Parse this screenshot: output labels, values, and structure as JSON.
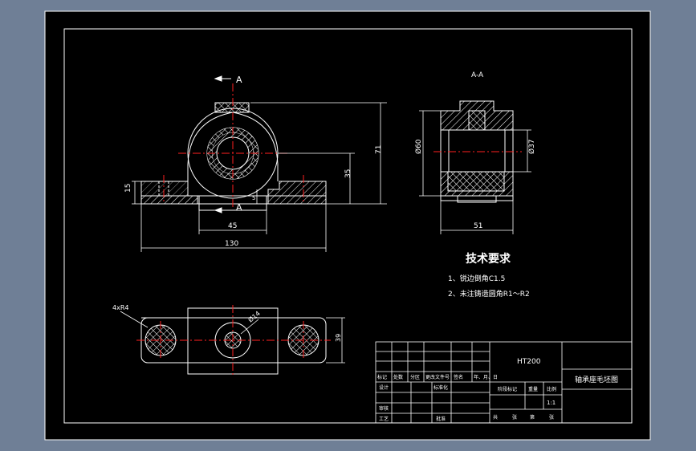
{
  "drawing": {
    "section_mark_top": "A",
    "section_mark_bottom": "A",
    "section_view_title": "A-A",
    "dimensions": {
      "front_height_total": "71",
      "front_center_height": "35",
      "front_base_thickness": "15",
      "front_small_dim": "5",
      "front_half_width": "45",
      "front_total_width": "130",
      "section_outer_dia": "Ø60",
      "section_inner_dia": "Ø37",
      "section_width": "51",
      "top_bolt_holes": "4xR4",
      "top_bore": "Ø14",
      "top_depth": "39"
    },
    "tech_requirements": {
      "title": "技术要求",
      "items": [
        "1、锐边倒角C1.5",
        "2、未注铸造圆角R1～R2"
      ]
    }
  },
  "title_block": {
    "material": "HT200",
    "part_name": "轴承座毛坯图",
    "scale": "1:1",
    "header_labels": [
      "标记",
      "处数",
      "分区",
      "更改文件号",
      "签名",
      "年、月、日"
    ],
    "left_labels": [
      "设计",
      "审核",
      "工艺"
    ],
    "middle_labels": [
      "标准化",
      "批准"
    ],
    "stage_labels": [
      "阶段标记",
      "重量",
      "比例"
    ],
    "sheet_labels": [
      "共",
      "张",
      "第",
      "张"
    ]
  },
  "colors": {
    "background": "#6f7f96",
    "sheet": "#000000",
    "line": "#ffffff",
    "centerline": "#ff2020",
    "hatch": "#ffffff"
  }
}
